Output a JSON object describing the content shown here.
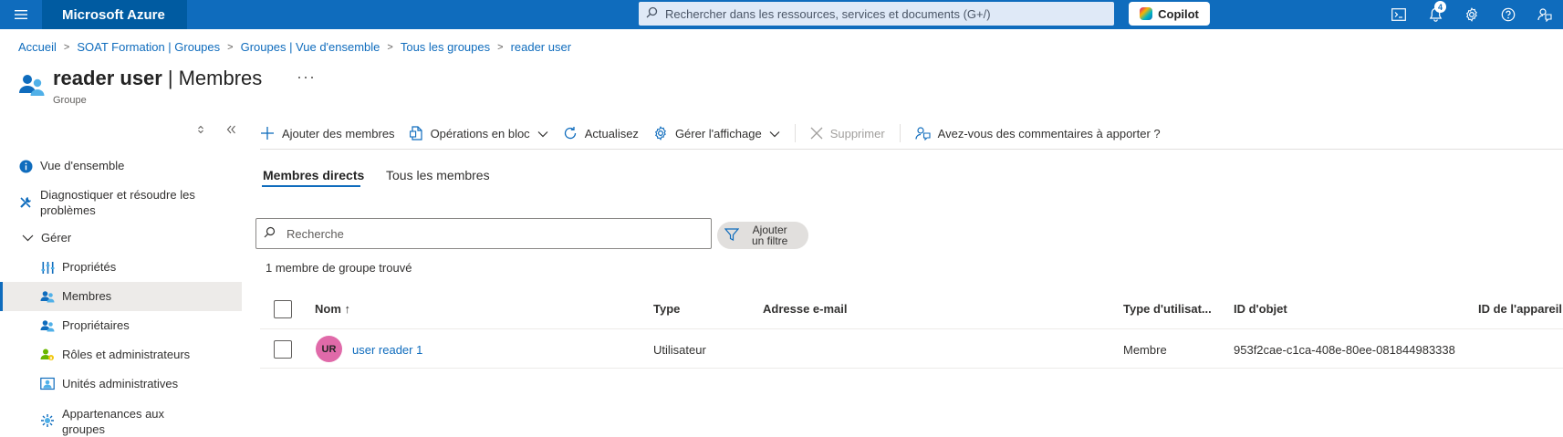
{
  "topbar": {
    "brand": "Microsoft Azure",
    "search_placeholder": "Rechercher dans les ressources, services et documents (G+/)",
    "copilot_label": "Copilot",
    "notification_count": "4",
    "icons": [
      "cloud-shell-icon",
      "notification-bell-icon",
      "settings-gear-icon",
      "help-icon",
      "feedback-icon"
    ]
  },
  "breadcrumb": [
    "Accueil",
    "SOAT Formation | Groupes",
    "Groupes | Vue d'ensemble",
    "Tous les groupes",
    "reader user"
  ],
  "page": {
    "title_bold": "reader user",
    "title_sep": "|",
    "title_section": "Membres",
    "more": "···",
    "subtitle": "Groupe"
  },
  "sidebar": {
    "items": [
      {
        "label": "Vue d'ensemble",
        "icon": "info-icon"
      },
      {
        "label": "Diagnostiquer et résoudre les problèmes",
        "icon": "wrench-icon"
      },
      {
        "label": "Gérer",
        "icon": "chevron-down-icon"
      },
      {
        "label": "Propriétés",
        "icon": "properties-icon"
      },
      {
        "label": "Membres",
        "icon": "members-icon",
        "active": true
      },
      {
        "label": "Propriétaires",
        "icon": "owners-icon"
      },
      {
        "label": "Rôles et administrateurs",
        "icon": "roles-icon"
      },
      {
        "label": "Unités administratives",
        "icon": "admin-units-icon"
      },
      {
        "label": "Appartenances aux groupes",
        "icon": "group-memberships-icon"
      }
    ]
  },
  "commands": {
    "add_members": "Ajouter des membres",
    "bulk_operations": "Opérations en bloc",
    "refresh": "Actualisez",
    "manage_view": "Gérer l'affichage",
    "delete": "Supprimer",
    "feedback": "Avez-vous des commentaires à apporter ?"
  },
  "tabs": {
    "direct": "Membres directs",
    "all": "Tous les membres"
  },
  "filter": {
    "search_placeholder": "Recherche",
    "add_filter_line1": "Ajouter",
    "add_filter_line2": "un filtre",
    "result_count": "1 membre de groupe trouvé"
  },
  "table": {
    "columns": [
      "Nom ↑",
      "Type",
      "Adresse e-mail",
      "Type d'utilisat...",
      "ID d'objet",
      "ID de l'appareil"
    ],
    "rows": [
      {
        "initials": "UR",
        "name": "user reader 1",
        "type": "Utilisateur",
        "email": "",
        "user_type": "Membre",
        "object_id": "953f2cae-c1ca-408e-80ee-081844983338",
        "device_id": ""
      }
    ]
  },
  "colors": {
    "azure_blue": "#0f6cbd",
    "brand_bg": "#005ba1",
    "avatar": "#e06aa9"
  }
}
